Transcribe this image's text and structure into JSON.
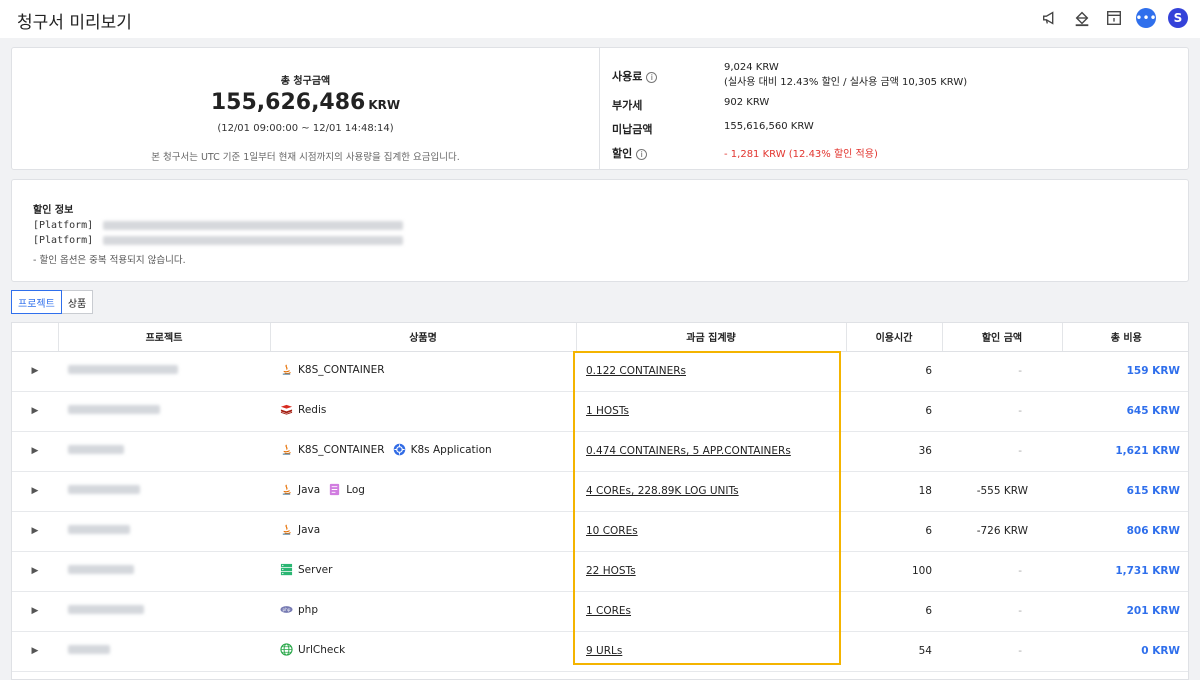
{
  "header": {
    "title": "청구서 미리보기",
    "avatar": "S"
  },
  "summary": {
    "total_label": "총 청구금액",
    "total_amount": "155,626,486",
    "total_unit": "KRW",
    "period": "(12/01 09:00:00 ~ 12/01 14:48:14)",
    "note": "본 청구서는 UTC 기준 1일부터 현재 시점까지의 사용량을 집계한 요금입니다.",
    "usage_label": "사용료",
    "usage_value": "9,024 KRW",
    "usage_detail": "(실사용 대비 12.43% 할인 / 실사용 금액 10,305 KRW)",
    "vat_label": "부가세",
    "vat_value": "902 KRW",
    "unpaid_label": "미납금액",
    "unpaid_value": "155,616,560 KRW",
    "discount_label": "할인",
    "discount_value": "- 1,281 KRW  (12.43% 할인 적용)"
  },
  "discount_info": {
    "title": "할인 정보",
    "lines": [
      "[Platform]",
      "[Platform]"
    ],
    "note": "- 할인 옵션은 중복 적용되지 않습니다."
  },
  "tabs": [
    "프로젝트",
    "상품"
  ],
  "table": {
    "columns": [
      "프로젝트",
      "상품명",
      "과금 집계량",
      "이용시간",
      "할인 금액",
      "총 비용"
    ],
    "rows": [
      {
        "products": [
          {
            "icon": "java-icon",
            "name": "K8S_CONTAINER"
          }
        ],
        "usage": "0.122 CONTAINERs",
        "hours": "6",
        "discount": "-",
        "cost": "159 KRW"
      },
      {
        "products": [
          {
            "icon": "redis-icon",
            "name": "Redis"
          }
        ],
        "usage": "1 HOSTs",
        "hours": "6",
        "discount": "-",
        "cost": "645 KRW"
      },
      {
        "products": [
          {
            "icon": "java-icon",
            "name": "K8S_CONTAINER"
          },
          {
            "icon": "kubernetes-icon",
            "name": "K8s Application"
          }
        ],
        "usage": "0.474 CONTAINERs, 5 APP.CONTAINERs",
        "hours": "36",
        "discount": "-",
        "cost": "1,621 KRW"
      },
      {
        "products": [
          {
            "icon": "java-icon",
            "name": "Java"
          },
          {
            "icon": "log-icon",
            "name": "Log"
          }
        ],
        "usage": "4 COREs, 228.89K LOG UNITs",
        "hours": "18",
        "discount": "-555 KRW",
        "cost": "615 KRW"
      },
      {
        "products": [
          {
            "icon": "java-icon",
            "name": "Java"
          }
        ],
        "usage": "10 COREs",
        "hours": "6",
        "discount": "-726 KRW",
        "cost": "806 KRW"
      },
      {
        "products": [
          {
            "icon": "server-icon",
            "name": "Server"
          }
        ],
        "usage": "22 HOSTs",
        "hours": "100",
        "discount": "-",
        "cost": "1,731 KRW"
      },
      {
        "products": [
          {
            "icon": "php-icon",
            "name": "php"
          }
        ],
        "usage": "1 COREs",
        "hours": "6",
        "discount": "-",
        "cost": "201 KRW"
      },
      {
        "products": [
          {
            "icon": "globe-icon",
            "name": "UrlCheck"
          }
        ],
        "usage": "9 URLs",
        "hours": "54",
        "discount": "-",
        "cost": "0 KRW"
      }
    ]
  },
  "colors": {
    "accent": "#2f6fec",
    "discount_red": "#e2352f",
    "highlight": "#f4b400"
  }
}
